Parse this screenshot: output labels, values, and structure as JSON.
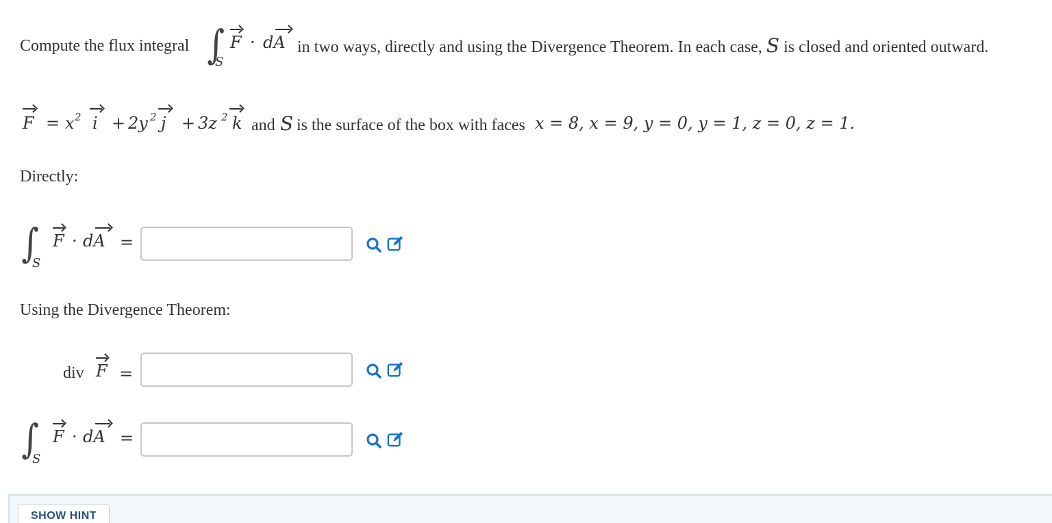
{
  "problem": {
    "prompt_before": "Compute the flux integral",
    "integral_vector_field": "F",
    "integral_dot": "·",
    "integral_differential": "dA",
    "integral_subscript": "S",
    "prompt_after": "in two ways, directly and using the Divergence Theorem. In each case,",
    "prompt_surface_var": "S",
    "prompt_end": "is closed and oriented outward.",
    "field_definition": {
      "lhs": "F",
      "equals": "=",
      "term1": "x",
      "term1_exp": "2",
      "unit1": "i",
      "plus1": "+",
      "term2": "2y",
      "term2_exp": "2",
      "unit2": "j",
      "plus2": "+",
      "term3": "3z",
      "term3_exp": "2",
      "unit3": "k",
      "and_text": "and",
      "surface_var": "S",
      "description": "is the surface of the box with faces",
      "faces": "x = 8, x = 9, y = 0, y = 1, z = 0, z = 1."
    }
  },
  "sections": {
    "directly_label": "Directly:",
    "divergence_label": "Using the Divergence Theorem:",
    "div_text": "div",
    "equals": "="
  },
  "answers": {
    "direct_flux": "",
    "div_f": "",
    "divergence_flux": ""
  },
  "icons": {
    "preview": "magnifier-icon",
    "edit": "edit-pencil-icon",
    "accent_color": "#1a73c8"
  },
  "hint": {
    "button_label": "SHOW HINT"
  }
}
